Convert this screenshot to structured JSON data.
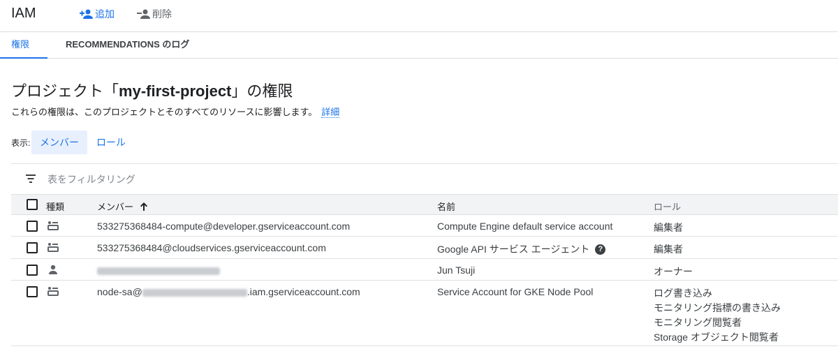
{
  "header": {
    "title": "IAM",
    "add_label": "追加",
    "delete_label": "削除"
  },
  "tabs": [
    {
      "label": "権限"
    },
    {
      "label": "RECOMMENDATIONS のログ"
    }
  ],
  "page": {
    "title_prefix": "プロジェクト「",
    "project": "my-first-project",
    "title_suffix": "」の権限",
    "description": "これらの権限は、このプロジェクトとそのすべてのリソースに影響します。",
    "details_link": "詳細"
  },
  "view": {
    "label": "表示:",
    "members": "メンバー",
    "roles": "ロール"
  },
  "filter": {
    "placeholder": "表をフィルタリング"
  },
  "table": {
    "headers": {
      "kind": "種類",
      "member": "メンバー",
      "name": "名前",
      "role": "ロール"
    },
    "rows": [
      {
        "kind_icon": "service-account-icon",
        "member": "533275368484-compute@developer.gserviceaccount.com",
        "name": "Compute Engine default service account",
        "roles": [
          "編集者"
        ]
      },
      {
        "kind_icon": "service-account-icon",
        "member": "533275368484@cloudservices.gserviceaccount.com",
        "name": "Google API サービス エージェント",
        "roles": [
          "編集者"
        ]
      },
      {
        "kind_icon": "person-icon",
        "member": "",
        "name": "Jun Tsuji",
        "roles": [
          "オーナー"
        ]
      },
      {
        "kind_icon": "service-account-icon",
        "member_prefix": "node-sa@",
        "member_suffix": ".iam.gserviceaccount.com",
        "name": "Service Account for GKE Node Pool",
        "roles": [
          "ログ書き込み",
          "モニタリング指標の書き込み",
          "モニタリング閲覧者",
          "Storage オブジェクト閲覧者"
        ]
      }
    ]
  }
}
